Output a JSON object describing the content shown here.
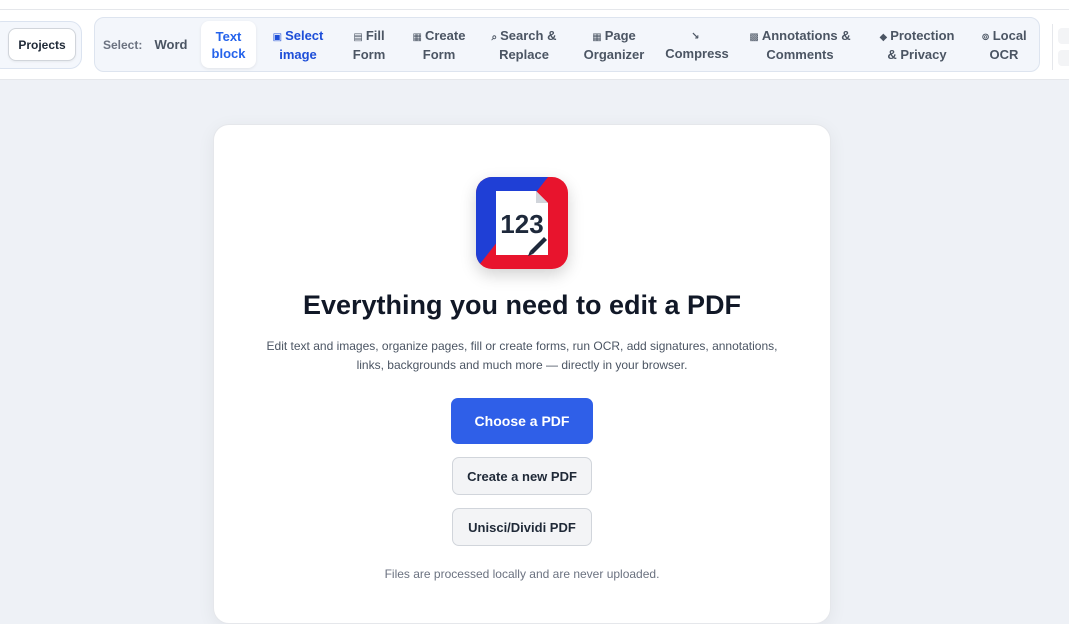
{
  "toolbar": {
    "projects_label": "Projects",
    "select_label": "Select:",
    "tools": [
      {
        "icon": "",
        "line1": "Word",
        "line2": ""
      },
      {
        "icon": "",
        "line1": "Text",
        "line2": "block"
      },
      {
        "icon": "▣",
        "line1": "Select",
        "line2": "image"
      },
      {
        "icon": "▤",
        "line1": "Fill",
        "line2": "Form"
      },
      {
        "icon": "▦",
        "line1": "Create",
        "line2": "Form"
      },
      {
        "icon": "⌕",
        "line1": "Search &",
        "line2": "Replace"
      },
      {
        "icon": "▦",
        "line1": "Page",
        "line2": "Organizer"
      },
      {
        "icon": "↘",
        "line1": "",
        "line2": "Compress"
      },
      {
        "icon": "▩",
        "line1": "Annotations &",
        "line2": "Comments"
      },
      {
        "icon": "◆",
        "line1": "Protection",
        "line2": "& Privacy"
      },
      {
        "icon": "⊚",
        "line1": "Local",
        "line2": "OCR"
      }
    ]
  },
  "logo": {
    "text": "123"
  },
  "main": {
    "headline": "Everything you need to edit a PDF",
    "subtext": "Edit text and images, organize pages, fill or create forms, run OCR, add signatures, annotations, links, backgrounds and much more — directly in your browser.",
    "choose_label": "Choose a PDF",
    "create_label": "Create a new PDF",
    "merge_label": "Unisci/Dividi PDF",
    "footnote": "Files are processed locally and are never uploaded."
  },
  "colors": {
    "accent": "#2f5fe8",
    "logo_blue": "#1f3fd6",
    "logo_red": "#e8142d"
  }
}
